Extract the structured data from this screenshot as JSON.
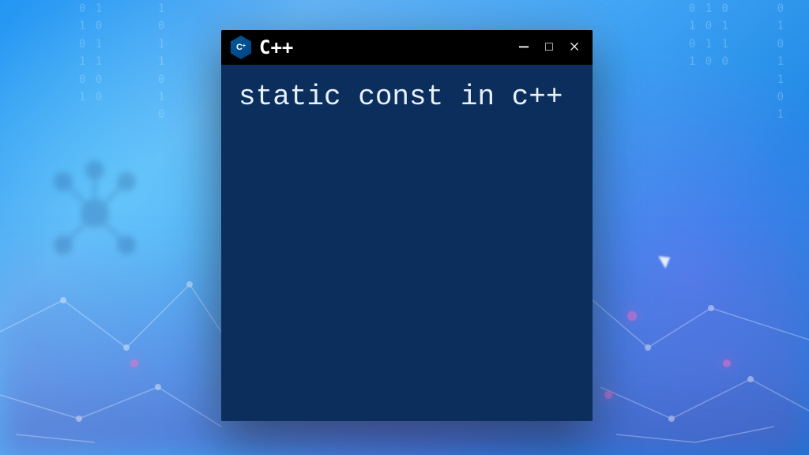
{
  "window": {
    "title": "C++",
    "logo_letter": "C",
    "logo_plus": "+",
    "controls": {
      "minimize": "−",
      "maximize": "□",
      "close": "×"
    }
  },
  "content": {
    "code": "static const in c++"
  },
  "background": {
    "digits_1": "0 1\n1 0\n0 1\n1 1\n0 0\n1 0",
    "digits_2": "1\n0\n1\n1\n0\n1\n0",
    "digits_3": "0 1 0\n1 0 1\n0 1 1\n1 0 0",
    "digits_4": "0\n1\n0\n1\n1\n0\n1"
  }
}
